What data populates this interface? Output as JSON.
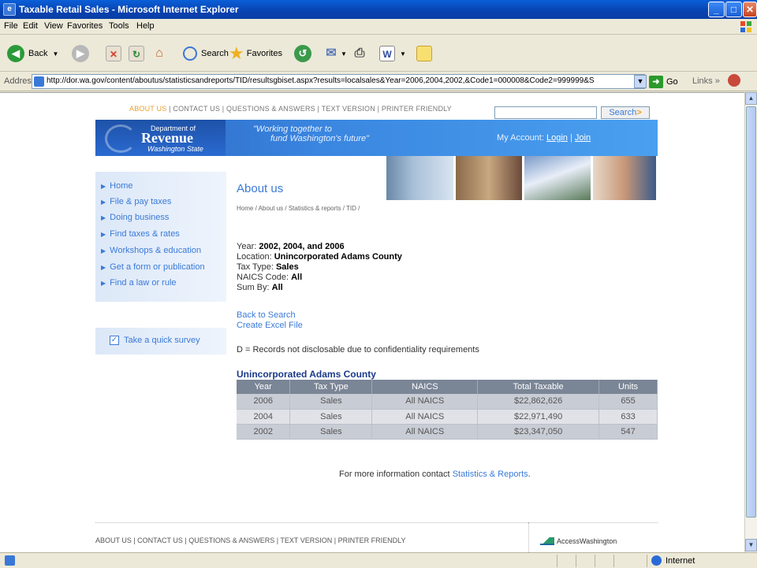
{
  "window": {
    "title": "Taxable Retail Sales - Microsoft Internet Explorer",
    "icon": "ie-page-icon"
  },
  "menubar": {
    "items": [
      "File",
      "Edit",
      "View",
      "Favorites",
      "Tools",
      "Help"
    ]
  },
  "toolbar": {
    "back_label": "Back",
    "search_label": "Search",
    "favorites_label": "Favorites"
  },
  "addressbar": {
    "label": "Address",
    "url": "http://dor.wa.gov/content/aboutus/statisticsandreports/TID/resultsgbiset.aspx?results=localsales&Year=2006,2004,2002,&Code1=000008&Code2=999999&S",
    "go_label": "Go",
    "links_label": "Links"
  },
  "site": {
    "top_links": [
      "ABOUT US",
      "CONTACT US",
      "QUESTIONS & ANSWERS",
      "TEXT VERSION",
      "PRINTER FRIENDLY"
    ],
    "search_button": "Search",
    "logo": {
      "line1": "Department of",
      "line2": "Revenue",
      "line3": "Washington State"
    },
    "tagline_1": "\"Working together to",
    "tagline_2": "fund Washington's future\"",
    "account": {
      "label": "My Account:",
      "login": "Login",
      "join": "Join"
    },
    "nav": [
      "Home",
      "File & pay taxes",
      "Doing business",
      "Find taxes & rates",
      "Workshops & education",
      "Get a form or publication",
      "Find a law or rule"
    ],
    "survey": "Take a quick survey",
    "heading": "About us",
    "breadcrumb": "Home / About us / Statistics & reports / TID /"
  },
  "query": {
    "year_label": "Year:",
    "year": "2002, 2004, and 2006",
    "location_label": "Location:",
    "location": "Unincorporated Adams County",
    "taxtype_label": "Tax Type:",
    "taxtype": "Sales",
    "naics_label": "NAICS Code:",
    "naics": "All",
    "sumby_label": "Sum By:",
    "sumby": "All"
  },
  "actions": {
    "back": "Back to Search",
    "excel": "Create Excel File"
  },
  "disclaimer": "D = Records not disclosable due to confidentiality requirements",
  "table": {
    "title": "Unincorporated Adams County",
    "headers": [
      "Year",
      "Tax Type",
      "NAICS",
      "Total Taxable",
      "Units"
    ],
    "rows": [
      [
        "2006",
        "Sales",
        "All NAICS",
        "$22,862,626",
        "655"
      ],
      [
        "2004",
        "Sales",
        "All NAICS",
        "$22,971,490",
        "633"
      ],
      [
        "2002",
        "Sales",
        "All NAICS",
        "$23,347,050",
        "547"
      ]
    ]
  },
  "contact": {
    "prefix": "For more information contact",
    "link": "Statistics & Reports",
    "suffix": "."
  },
  "footer": {
    "links": "ABOUT US | CONTACT US | QUESTIONS & ANSWERS | TEXT VERSION | PRINTER FRIENDLY",
    "access": "AccessWashington"
  },
  "statusbar": {
    "zone": "Internet"
  },
  "colors": {
    "link": "#3a7ad8",
    "banner": "#2a64c0",
    "table_header": "#7a8596",
    "accent": "#e8a030"
  }
}
